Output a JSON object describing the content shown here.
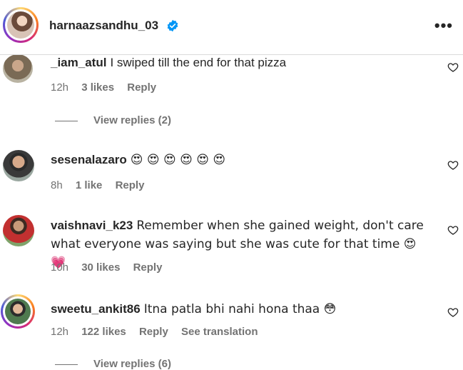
{
  "post": {
    "username": "harnaazsandhu_03"
  },
  "comments": [
    {
      "user": "_iam_atul",
      "text": "I swiped till the end for that pizza",
      "time": "12h",
      "likes": "3 likes",
      "reply": "Reply",
      "view_replies": "View replies (2)"
    },
    {
      "user": "sesenalazaro",
      "text": "😍 😍 😍 😍 😍 😍",
      "time": "8h",
      "likes": "1 like",
      "reply": "Reply"
    },
    {
      "user": "vaishnavi_k23",
      "text": "Remember when she gained weight, don't care what everyone was saying but she was cute for that time 😍 💗",
      "time": "10h",
      "likes": "30 likes",
      "reply": "Reply"
    },
    {
      "user": "sweetu_ankit86",
      "text": "Itna patla bhi nahi hona thaa 😳",
      "time": "12h",
      "likes": "122 likes",
      "reply": "Reply",
      "see_translation": "See translation",
      "view_replies": "View replies (6)"
    }
  ],
  "colors": {
    "primary_text": "#262626",
    "secondary_text": "#737373",
    "verified_blue": "#0095f6"
  },
  "icons": [
    "verified-badge-icon",
    "more-options-icon",
    "heart-icon"
  ]
}
